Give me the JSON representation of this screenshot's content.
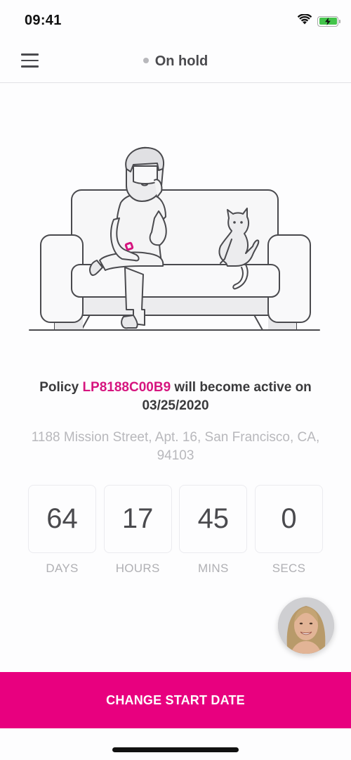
{
  "status_bar": {
    "time": "09:41",
    "icons": [
      "wifi-icon",
      "battery-charging-icon"
    ]
  },
  "nav": {
    "menu_icon": "hamburger-menu-icon",
    "status_dot_color": "#b8b8bc",
    "title": "On hold"
  },
  "illustration": {
    "description": "man-and-cat-on-sofa"
  },
  "policy": {
    "prefix": "Policy ",
    "id": "LP8188C00B9",
    "suffix": " will become active on 03/25/2020",
    "address": "1188 Mission Street, Apt. 16, San Francisco, CA, 94103"
  },
  "countdown": [
    {
      "value": "64",
      "label": "DAYS"
    },
    {
      "value": "17",
      "label": "HOURS"
    },
    {
      "value": "45",
      "label": "MINS"
    },
    {
      "value": "0",
      "label": "SECS"
    }
  ],
  "agent": {
    "avatar": "agent-avatar-photo"
  },
  "cta": {
    "label": "CHANGE START DATE"
  },
  "colors": {
    "accent": "#e8007f",
    "policy_id": "#d6157f"
  }
}
